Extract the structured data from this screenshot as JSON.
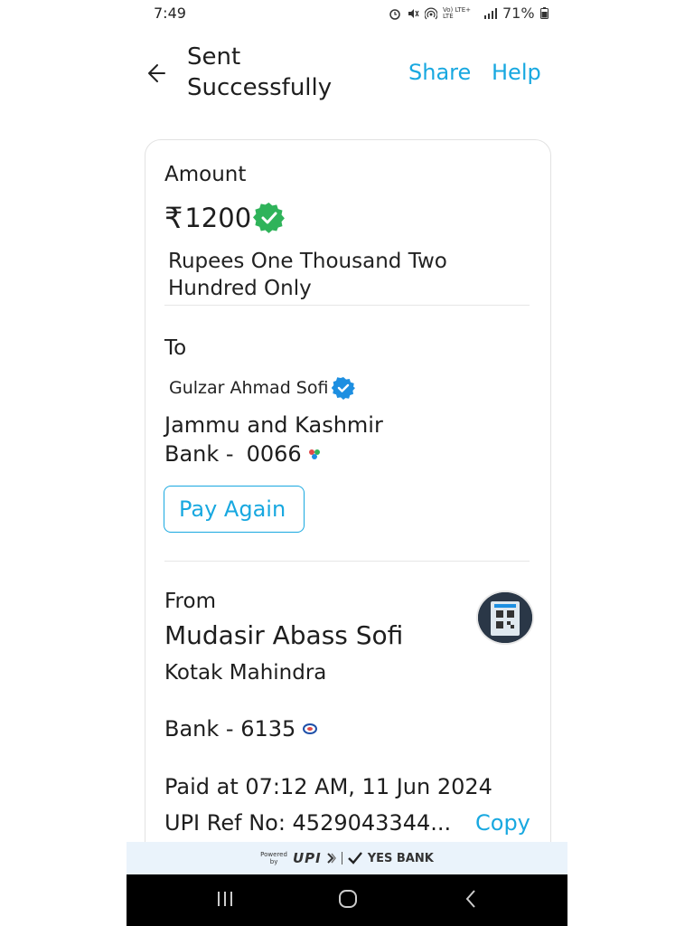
{
  "status_bar": {
    "time": "7:49",
    "battery": "71%",
    "network": "Vo) LTE+ LTE"
  },
  "header": {
    "title_line1": "Sent",
    "title_line2": "Successfully",
    "share_label": "Share",
    "help_label": "Help"
  },
  "amount": {
    "label": "Amount",
    "currency_symbol": "₹",
    "value": "1200",
    "words_line1": "Rupees One Thousand  Two",
    "words_line2": "Hundred Only"
  },
  "to": {
    "label": "To",
    "name": "Gulzar Ahmad Sofi",
    "bank_line1": "Jammu and Kashmir",
    "bank_prefix": "Bank -",
    "account_suffix": "0066",
    "pay_again_label": "Pay Again"
  },
  "from": {
    "label": "From",
    "name": "Mudasir Abass Sofi",
    "bank_line1": "Kotak Mahindra",
    "bank_line2": "Bank - 6135"
  },
  "details": {
    "paid_at": "Paid at 07:12 AM, 11 Jun 2024",
    "upi_ref": "UPI Ref No: 4529043344...",
    "copy_label": "Copy"
  },
  "footer": {
    "powered_by_line1": "Powered",
    "powered_by_line2": "by",
    "upi_label": "UPI",
    "bank_label": "YES BANK"
  },
  "colors": {
    "accent": "#18a8e0",
    "verified_green": "#2fb35a",
    "verified_blue": "#1d8fe1"
  }
}
